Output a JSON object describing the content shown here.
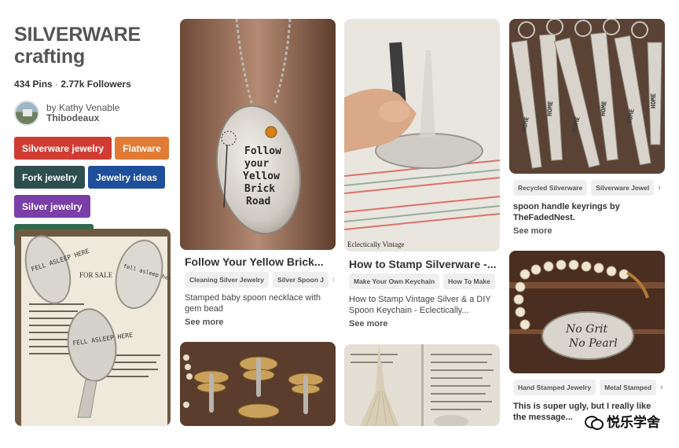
{
  "board": {
    "title_line1": "SILVERWARE",
    "title_line2": "crafting",
    "pins_count": "434 Pins",
    "separator": " · ",
    "followers": "2.77k Followers",
    "owner_by": "by Kathy Venable",
    "owner_last": "Thibodeaux"
  },
  "chips": [
    {
      "label": "Silverware jewelry",
      "color": "#d03c32"
    },
    {
      "label": "Flatware",
      "color": "#e07a35"
    },
    {
      "label": "Fork jewelry",
      "color": "#2e4d4e"
    },
    {
      "label": "Jewelry ideas",
      "color": "#1f4f9a"
    },
    {
      "label": "Silver jewelry",
      "color": "#7a3ea8"
    },
    {
      "label": "Spoon jewelry",
      "color": "#2e6a4e"
    }
  ],
  "pins": {
    "spoon_necklace": {
      "title": "Follow Your Yellow Brick...",
      "tags": [
        "Cleaning Silver Jewelry",
        "Silver Spoon J"
      ],
      "description": "Stamped baby spoon necklace with gem bead",
      "see_more": "See more",
      "image_text": [
        "Follow",
        "your",
        "Yellow",
        "Brick",
        "Road"
      ]
    },
    "stamp_silverware": {
      "title": "How to Stamp Silverware -...",
      "tags": [
        "Make Your Own Keychain",
        "How To Make"
      ],
      "description": "How to Stamp Vintage Silver & a DIY Spoon Keychain - Eclectically...",
      "see_more": "See more",
      "image_caption": "Eclectically Vintage"
    },
    "keyrings": {
      "tags": [
        "Recycled Silverware",
        "Silverware Jewel"
      ],
      "description": "spoon handle keyrings by TheFadedNest.",
      "see_more": "See more",
      "image_words": [
        "HOME",
        "HOME",
        "HOME",
        "HOME",
        "HOME",
        "HOME",
        "HOME",
        "HOME"
      ]
    },
    "no_grit": {
      "tags": [
        "Hand Stamped Jewelry",
        "Metal Stamped"
      ],
      "description": "This is super ugly, but I really like the message...",
      "image_text": [
        "No Grit",
        "No Pearl"
      ]
    },
    "fell_asleep": {
      "image_words": [
        "FELL ASLEEP HERE",
        "fell asleep here",
        "FELL ASLEEP HERE"
      ],
      "book_label": "FOR SALE"
    }
  },
  "watermark": "悦乐学舍",
  "icons": {
    "tag_next": "›",
    "wechat": "wechat-icon"
  }
}
